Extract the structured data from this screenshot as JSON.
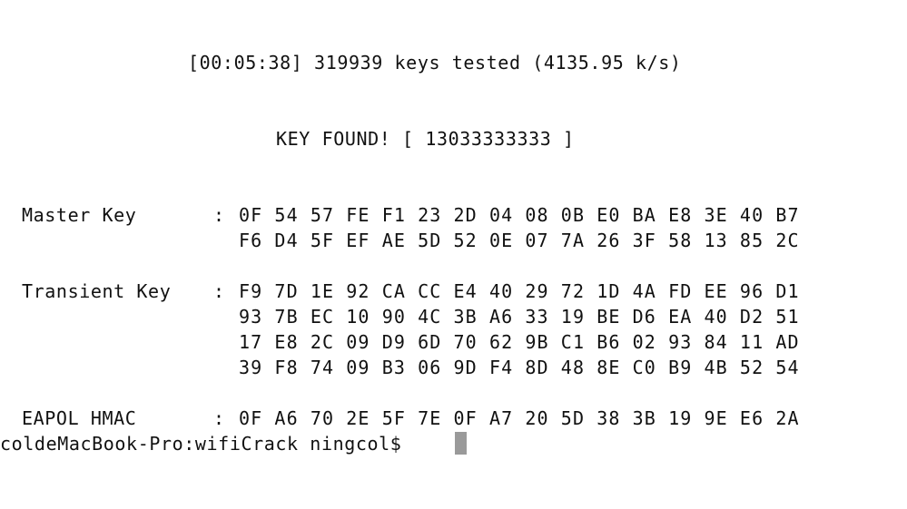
{
  "terminal": {
    "progress_line": "[00:05:38] 319939 keys tested (4135.95 k/s)",
    "key_found_line": "KEY FOUND! [ 13033333333 ]",
    "master_key": {
      "label": "Master Key",
      "separator": ":",
      "rows": [
        "0F 54 57 FE F1 23 2D 04 08 0B E0 BA E8 3E 40 B7",
        "F6 D4 5F EF AE 5D 52 0E 07 7A 26 3F 58 13 85 2C"
      ]
    },
    "transient_key": {
      "label": "Transient Key",
      "separator": ":",
      "rows": [
        "F9 7D 1E 92 CA CC E4 40 29 72 1D 4A FD EE 96 D1",
        "93 7B EC 10 90 4C 3B A6 33 19 BE D6 EA 40 D2 51",
        "17 E8 2C 09 D9 6D 70 62 9B C1 B6 02 93 84 11 AD",
        "39 F8 74 09 B3 06 9D F4 8D 48 8E C0 B9 4B 52 54"
      ]
    },
    "eapol_hmac": {
      "label": "EAPOL HMAC",
      "separator": ":",
      "rows": [
        "0F A6 70 2E 5F 7E 0F A7 20 5D 38 3B 19 9E E6 2A"
      ]
    },
    "prompt": "coldeMacBook-Pro:wifiCrack ningcol$"
  }
}
